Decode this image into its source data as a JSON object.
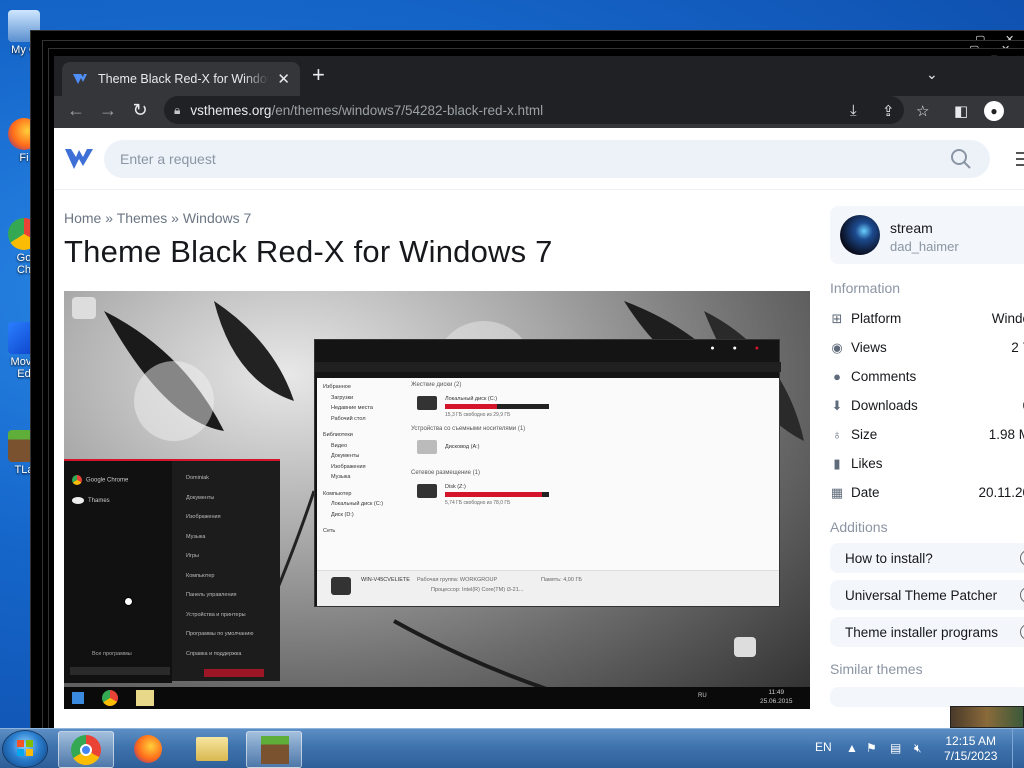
{
  "desktop": {
    "icons": [
      {
        "label": "My C",
        "icon": "computer-icon"
      },
      {
        "label": "Fi",
        "icon": "firefox-icon"
      },
      {
        "label": "Go\nCh",
        "icon": "chrome-icon"
      },
      {
        "label": "Mova\nEd",
        "icon": "movavi-icon"
      },
      {
        "label": "TLa",
        "icon": "minecraft-icon"
      }
    ]
  },
  "browser": {
    "tab_title": "Theme Black Red-X for Windows 7",
    "url_host": "vsthemes.org",
    "url_path": "/en/themes/windows7/54282-black-red-x.html"
  },
  "site": {
    "search_placeholder": "Enter a request",
    "breadcrumbs": [
      "Home",
      "Themes",
      "Windows 7"
    ],
    "breadcrumb_sep": "»",
    "title": "Theme Black Red-X for Windows 7",
    "author": {
      "name": "stream",
      "username": "dad_haimer"
    },
    "info_heading": "Information",
    "info": [
      {
        "label": "Platform",
        "value": "Windo",
        "icon": "windows-icon"
      },
      {
        "label": "Views",
        "value": "2 7",
        "icon": "eye-icon"
      },
      {
        "label": "Comments",
        "value": "",
        "icon": "comment-icon"
      },
      {
        "label": "Downloads",
        "value": "6",
        "icon": "download-icon"
      },
      {
        "label": "Size",
        "value": "1.98 M",
        "icon": "weight-icon"
      },
      {
        "label": "Likes",
        "value": "",
        "icon": "likes-icon"
      },
      {
        "label": "Date",
        "value": "20.11.20",
        "icon": "calendar-icon"
      }
    ],
    "additions_heading": "Additions",
    "additions": [
      "How to install?",
      "Universal Theme Patcher",
      "Theme installer programs"
    ],
    "similar_heading": "Similar themes"
  },
  "preview": {
    "explorer": {
      "sidebar": [
        "Избранное",
        "Загрузки",
        "Недавние места",
        "Рабочий стол",
        "Библиотеки",
        "Видео",
        "Документы",
        "Изображения",
        "Музыка",
        "Компьютер",
        "Локальный диск (C:)",
        "Диск (D:)",
        "Сеть"
      ],
      "group1": "Жесткие диски (2)",
      "drive1": "Локальный диск (C:)",
      "drive1_free": "15,3 ГБ свободно из 29,9 ГБ",
      "group2": "Устройства со съемными носителями (1)",
      "drive2": "Дисковод (A:)",
      "group3": "Сетевое размещение (1)",
      "drive3": "Disk (Z:)",
      "drive3_free": "5,74 ГБ свободно из 78,0 ГБ",
      "pc_name": "WIN-V45CVELIETE",
      "workgroup": "Рабочая группа: WORKGROUP",
      "memory": "Память: 4,00 ГБ",
      "cpu": "Процессор: Intel(R) Core(TM) i3-21..."
    },
    "start_menu": {
      "left": [
        "Google Chrome",
        "Thames"
      ],
      "all_programs": "Все программы",
      "right": [
        "Dominiak",
        "Документы",
        "Изображения",
        "Музыка",
        "Игры",
        "Компьютер",
        "Панель управления",
        "Устройства и принтеры",
        "Программы по умолчанию",
        "Справка и поддержка"
      ]
    },
    "clock_time": "11:49",
    "clock_date": "25.06.2015",
    "lang": "RU"
  },
  "taskbar": {
    "lang": "EN",
    "time": "12:15 AM",
    "date": "7/15/2023"
  },
  "colors": {
    "chrome_dark": "#202124",
    "chrome_tab": "#35363a",
    "site_accent": "#3d6fd6",
    "theme_red": "#d3142a"
  }
}
